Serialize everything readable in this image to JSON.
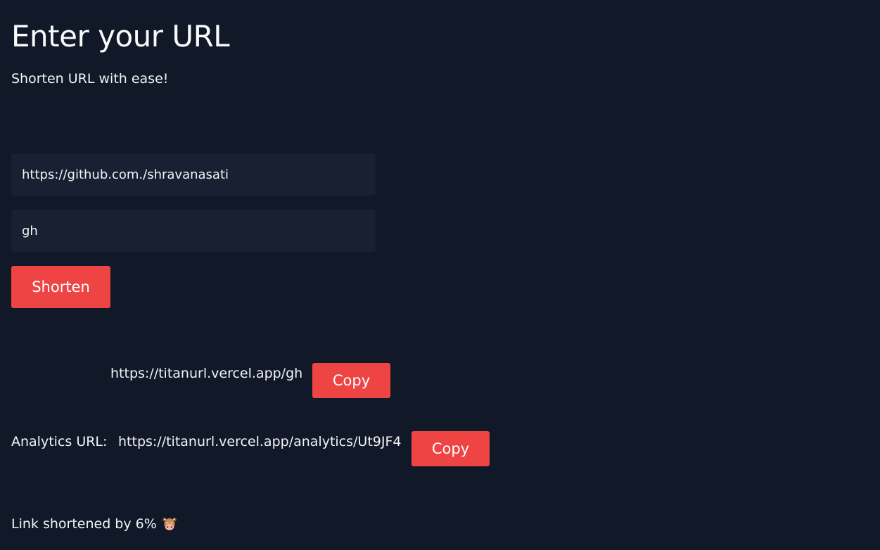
{
  "header": {
    "title": "Enter your URL",
    "subtitle": "Shorten URL with ease!"
  },
  "form": {
    "url_value": "https://github.com./shravanasati",
    "alias_value": "gh",
    "shorten_label": "Shorten"
  },
  "result": {
    "short_url": "https://titanurl.vercel.app/gh",
    "copy_label": "Copy",
    "analytics_label": "Analytics URL:",
    "analytics_url": "https://titanurl.vercel.app/analytics/Ut9JF4",
    "analytics_copy_label": "Copy",
    "status_text": "Link shortened by 6%",
    "status_icon": "cow-face-icon"
  },
  "colors": {
    "background": "#111827",
    "input_background": "#182031",
    "accent": "#ef4444",
    "text": "#f3f4f6"
  }
}
